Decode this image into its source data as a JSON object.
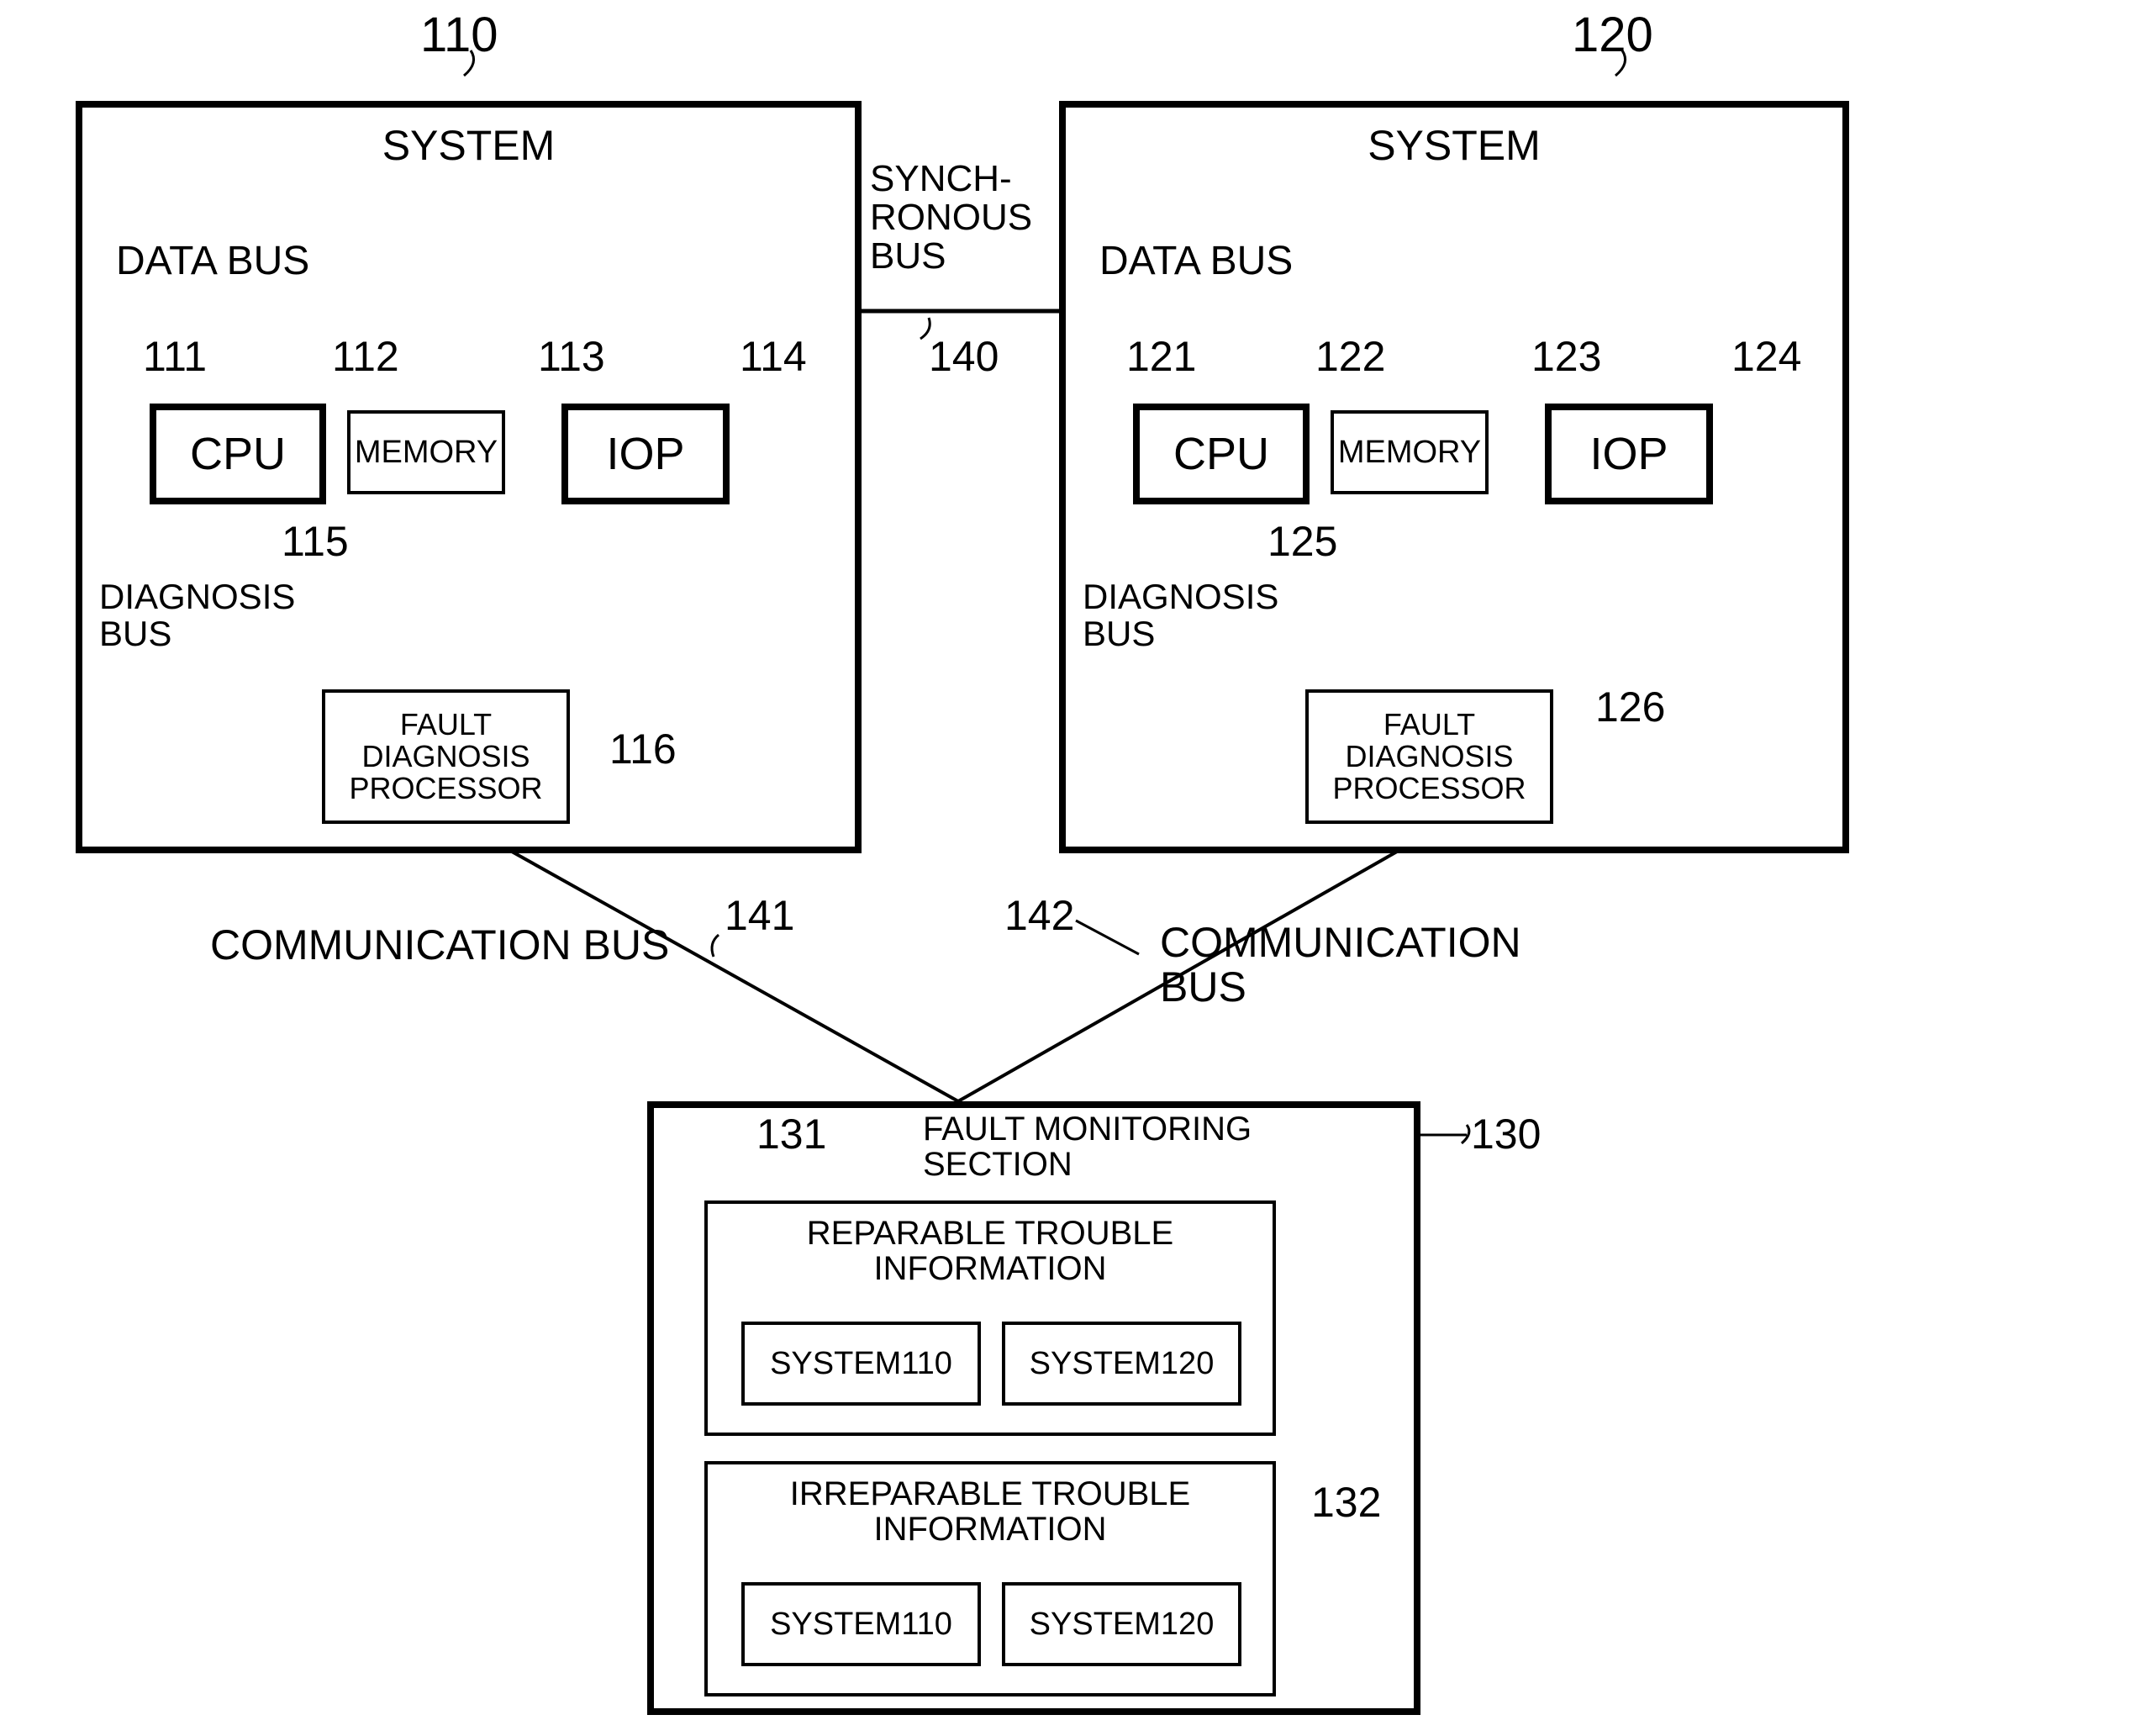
{
  "refnum": {
    "n110": "110",
    "n120": "120",
    "n111": "111",
    "n112": "112",
    "n113": "113",
    "n114": "114",
    "n115": "115",
    "n116": "116",
    "n121": "121",
    "n122": "122",
    "n123": "123",
    "n124": "124",
    "n125": "125",
    "n126": "126",
    "n130": "130",
    "n131": "131",
    "n132": "132",
    "n140": "140",
    "n141": "141",
    "n142": "142"
  },
  "labels": {
    "system": "SYSTEM",
    "data_bus": "DATA BUS",
    "sync_bus": "SYNCH-\nRONOUS\nBUS",
    "diagnosis_bus": "DIAGNOSIS\nBUS",
    "communication_bus": "COMMUNICATION BUS",
    "communication_bus_2": "COMMUNICATION\nBUS",
    "fault_monitoring": "FAULT MONITORING\nSECTION",
    "reparable": "REPARABLE TROUBLE\nINFORMATION",
    "irreparable": "IRREPARABLE TROUBLE\nINFORMATION",
    "sys110": "SYSTEM110",
    "sys120": "SYSTEM120"
  },
  "blocks": {
    "cpu": "CPU",
    "memory": "MEMORY",
    "iop": "IOP",
    "fdp": "FAULT\nDIAGNOSIS\nPROCESSOR"
  }
}
